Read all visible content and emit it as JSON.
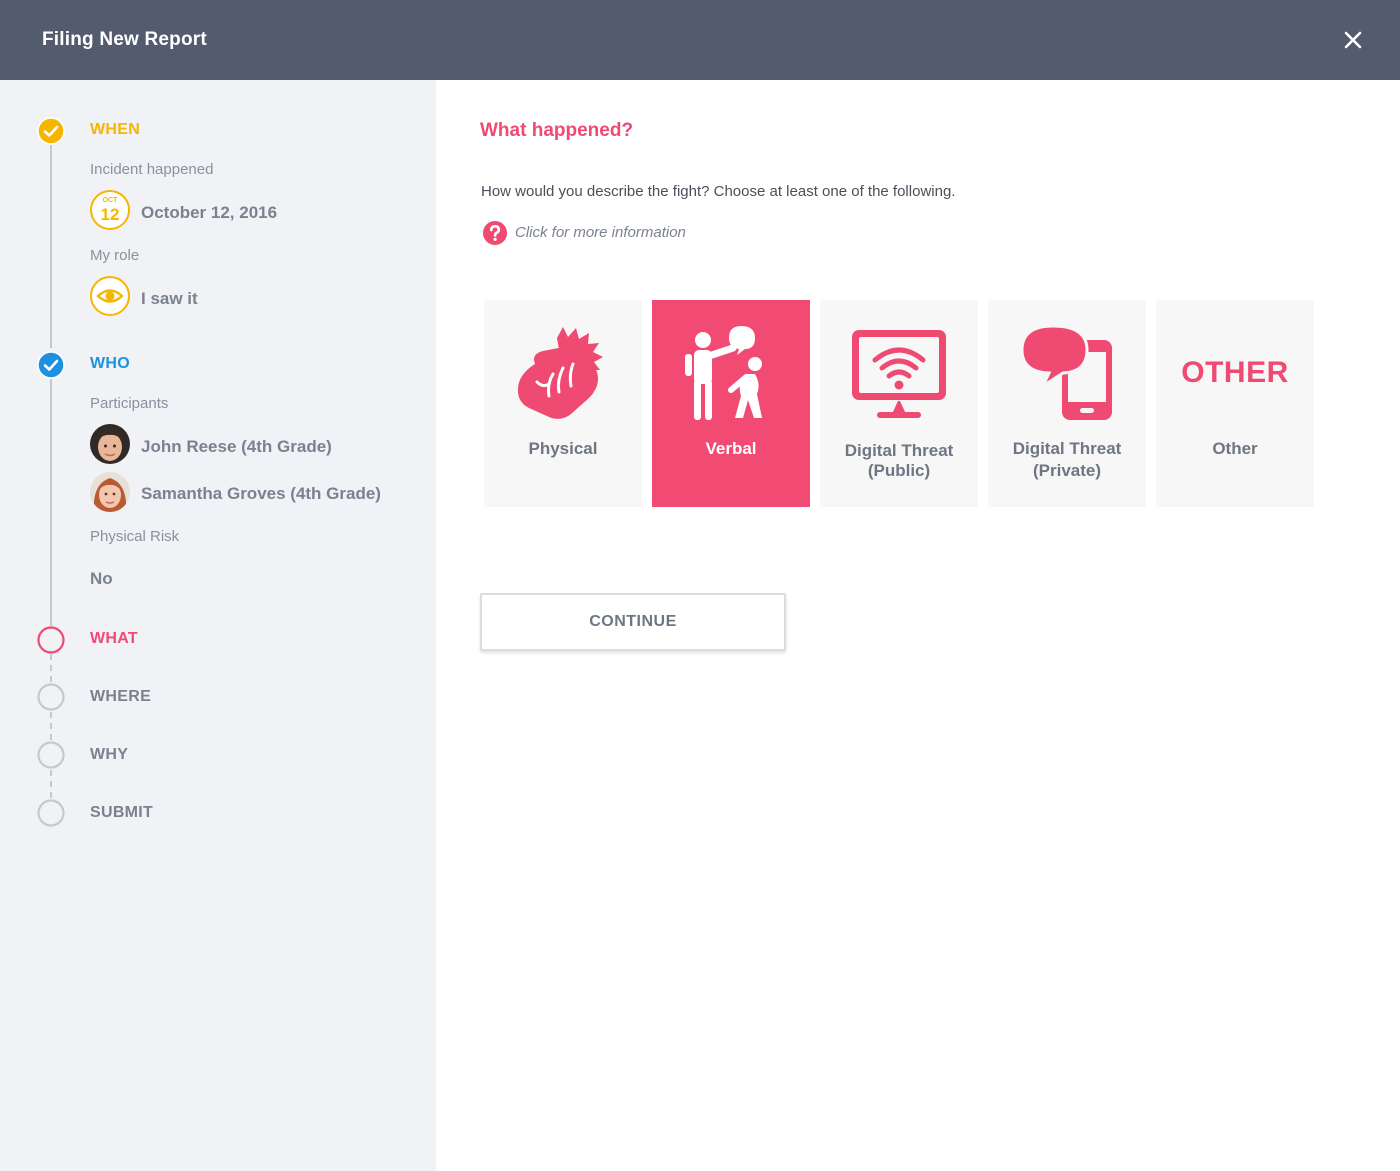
{
  "header": {
    "title": "Filing New Report",
    "close_icon": "close-icon"
  },
  "sidebar": {
    "when": {
      "label": "WHEN",
      "incident_label": "Incident happened",
      "date_month": "OCT",
      "date_day": "12",
      "date_text": "October 12, 2016",
      "role_label": "My role",
      "role_value": "I saw it"
    },
    "who": {
      "label": "WHO",
      "participants_label": "Participants",
      "participants": [
        "John Reese (4th Grade)",
        "Samantha Groves (4th Grade)"
      ],
      "risk_label": "Physical Risk",
      "risk_value": "No"
    },
    "steps_pending": [
      "WHAT",
      "WHERE",
      "WHY",
      "SUBMIT"
    ]
  },
  "main": {
    "title": "What happened?",
    "description": "How would you describe the fight? Choose at least one of the following.",
    "info_link": "Click for more information",
    "options": [
      {
        "label": "Physical",
        "selected": false
      },
      {
        "label": "Verbal",
        "selected": true
      },
      {
        "label_line1": "Digital Threat",
        "label_line2": "(Public)",
        "selected": false
      },
      {
        "label_line1": "Digital Threat",
        "label_line2": "(Private)",
        "selected": false
      },
      {
        "icon_word": "OTHER",
        "label": "Other",
        "selected": false
      }
    ],
    "continue_label": "CONTINUE"
  },
  "colors": {
    "header_bg": "#525c6e",
    "accent_pink": "#ef4a72",
    "when_yellow": "#f7b500",
    "who_blue": "#1e90e0",
    "sidebar_bg": "#f0f2f5"
  }
}
